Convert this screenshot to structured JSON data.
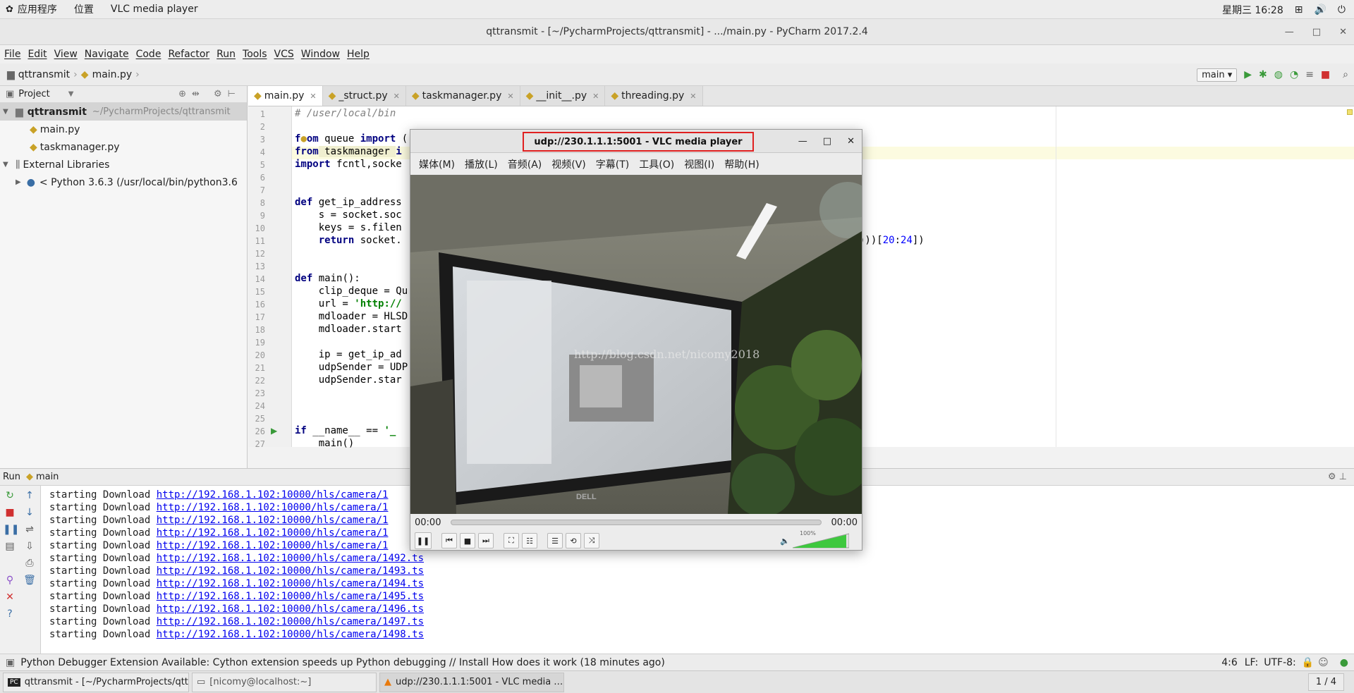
{
  "gnome_top": {
    "apps": "应用程序",
    "places": "位置",
    "active_app": "VLC media player",
    "clock": "星期三 16:28"
  },
  "window_title": "qttransmit - [~/PycharmProjects/qttransmit] - .../main.py - PyCharm 2017.2.4",
  "menu": [
    "File",
    "Edit",
    "View",
    "Navigate",
    "Code",
    "Refactor",
    "Run",
    "Tools",
    "VCS",
    "Window",
    "Help"
  ],
  "breadcrumb": {
    "project": "qttransmit",
    "file": "main.py"
  },
  "run_config": "main",
  "sidebar": {
    "header": "Project",
    "root": {
      "name": "qttransmit",
      "path": "~/PycharmProjects/qttransmit"
    },
    "files": [
      "main.py",
      "taskmanager.py"
    ],
    "external": "External Libraries",
    "python": "< Python 3.6.3 (/usr/local/bin/python3.6"
  },
  "tabs": [
    "main.py",
    "_struct.py",
    "taskmanager.py",
    "__init__.py",
    "threading.py"
  ],
  "code": {
    "line_numbers": [
      "1",
      "2",
      "3",
      "4",
      "5",
      "6",
      "7",
      "8",
      "9",
      "10",
      "11",
      "12",
      "13",
      "14",
      "15",
      "16",
      "17",
      "18",
      "19",
      "20",
      "21",
      "22",
      "23",
      "24",
      "25",
      "26",
      "27"
    ],
    "l1": "# /user/local/bin",
    "l3a": "f",
    "l3b": "om",
    "l3c": " queue ",
    "l3d": "import",
    "l3e": " (",
    "l4a": "from",
    "l4b": " taskmanager ",
    "l4c": "i",
    "l5a": "import",
    "l5b": " fcntl,socke",
    "l9a": "def",
    "l9b": " get_ip_address",
    "l10": "    s = socket.soc",
    "l11": "    keys = s.filen",
    "l12a": "    ",
    "l12b": "return",
    "l12c": " socket.",
    "l12tail_a": ")))[",
    "l12tail_b": "20",
    "l12tail_c": ":",
    "l12tail_d": "24",
    "l12tail_e": "])",
    "l15a": "def",
    "l15b": " main():",
    "l16": "    clip_deque = Qu",
    "l17a": "    url = ",
    "l17b": "'http://",
    "l18": "    mdloader = HLSD",
    "l19": "    mdloader.start",
    "l21": "    ip = get_ip_ad",
    "l22": "    udpSender = UDP",
    "l23": "    udpSender.star",
    "l26a": "if",
    "l26b": " __name__ == ",
    "l26c": "'_",
    "l27": "    main()"
  },
  "run_panel": {
    "label": "Run",
    "config": "main",
    "prefix": "starting Download ",
    "partial_url": "http://192.168.1.102:10000/hls/camera/1",
    "urls": [
      "http://192.168.1.102:10000/hls/camera/1492.ts",
      "http://192.168.1.102:10000/hls/camera/1493.ts",
      "http://192.168.1.102:10000/hls/camera/1494.ts",
      "http://192.168.1.102:10000/hls/camera/1495.ts",
      "http://192.168.1.102:10000/hls/camera/1496.ts",
      "http://192.168.1.102:10000/hls/camera/1497.ts",
      "http://192.168.1.102:10000/hls/camera/1498.ts"
    ]
  },
  "status": {
    "message": "Python Debugger Extension Available: Cython extension speeds up Python debugging // Install How does it work (18 minutes ago)",
    "position": "4:6",
    "line_sep": "LF:",
    "encoding": "UTF-8:"
  },
  "taskbar": {
    "tasks": [
      "qttransmit - [~/PycharmProjects/qtt…",
      "[nicomy@localhost:~]",
      "udp://230.1.1.1:5001 - VLC media …"
    ],
    "pager": "1 / 4"
  },
  "vlc": {
    "title": "udp://230.1.1.1:5001 - VLC media player",
    "menu": [
      "媒体(M)",
      "播放(L)",
      "音频(A)",
      "视频(V)",
      "字幕(T)",
      "工具(O)",
      "视图(I)",
      "帮助(H)"
    ],
    "time_elapsed": "00:00",
    "time_total": "00:00",
    "volume": "100%",
    "watermark": "http://blog.csdn.net/nicomy2018",
    "monitor_brand": "DELL"
  }
}
